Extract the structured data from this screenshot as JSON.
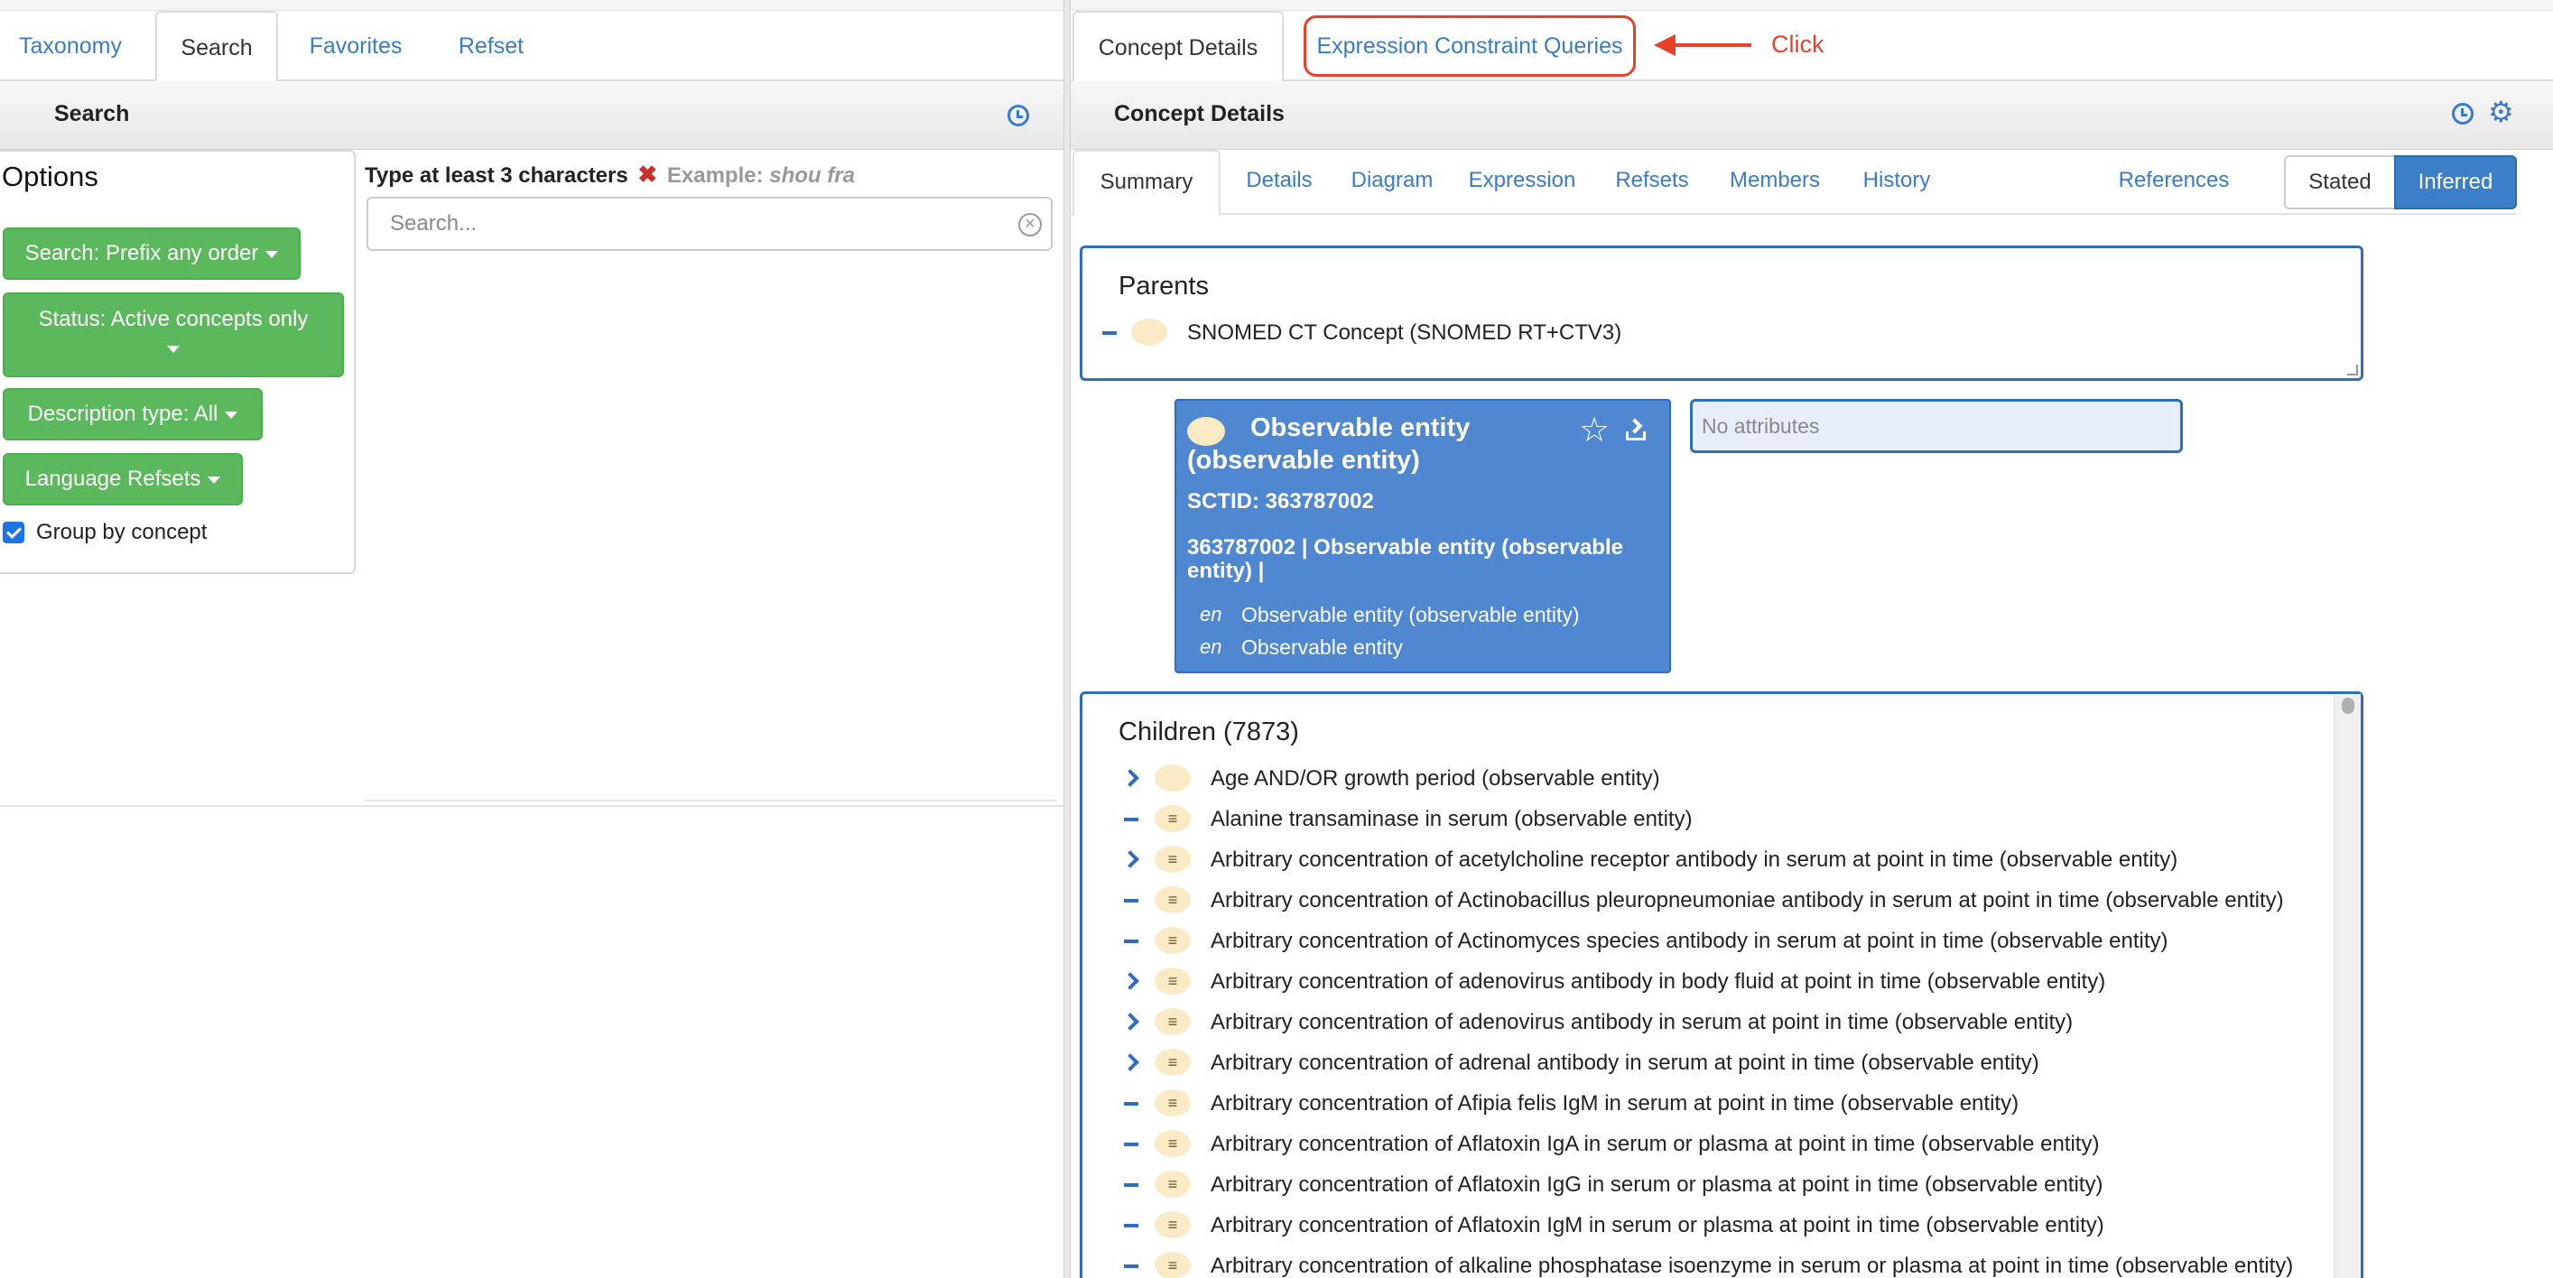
{
  "left": {
    "tabs": [
      "Taxonomy",
      "Search",
      "Favorites",
      "Refset"
    ],
    "active_tab": "Search",
    "panel_title": "Search",
    "options": {
      "title": "Options",
      "search_mode": "Search: Prefix any order",
      "status": "Status: Active concepts only",
      "description_type": "Description type: All",
      "language_refsets": "Language Refsets",
      "group_by_concept": "Group by concept",
      "group_by_checked": true
    },
    "hint": {
      "text": "Type at least 3 characters",
      "x": "✖",
      "example_label": "Example:",
      "example_value": "shou fra"
    },
    "search_placeholder": "Search..."
  },
  "right": {
    "tabs": [
      "Concept Details",
      "Expression Constraint Queries"
    ],
    "active_tab": "Concept Details",
    "annotation": "Click",
    "panel_title": "Concept Details",
    "subtabs": [
      "Summary",
      "Details",
      "Diagram",
      "Expression",
      "Refsets",
      "Members",
      "History",
      "References"
    ],
    "active_subtab": "Summary",
    "view_toggle": {
      "stated": "Stated",
      "inferred": "Inferred",
      "selected": "Inferred"
    },
    "parents": {
      "title": "Parents",
      "items": [
        "SNOMED CT Concept (SNOMED RT+CTV3)"
      ]
    },
    "focus": {
      "fsn": "Observable entity (observable entity)",
      "sctid": "SCTID: 363787002",
      "full_term": "363787002 | Observable entity (observable entity) |",
      "descriptions": [
        {
          "lang": "en",
          "term": "Observable entity (observable entity)"
        },
        {
          "lang": "en",
          "term": "Observable entity"
        }
      ]
    },
    "attributes_placeholder": "No attributes",
    "children": {
      "title": "Children (7873)",
      "items": [
        {
          "label": "Age AND/OR growth period (observable entity)",
          "expand": true,
          "primitive": true
        },
        {
          "label": "Alanine transaminase in serum (observable entity)",
          "expand": false,
          "primitive": false
        },
        {
          "label": "Arbitrary concentration of acetylcholine receptor antibody in serum at point in time (observable entity)",
          "expand": true,
          "primitive": false
        },
        {
          "label": "Arbitrary concentration of Actinobacillus pleuropneumoniae antibody in serum at point in time (observable entity)",
          "expand": false,
          "primitive": false
        },
        {
          "label": "Arbitrary concentration of Actinomyces species antibody in serum at point in time (observable entity)",
          "expand": false,
          "primitive": false
        },
        {
          "label": "Arbitrary concentration of adenovirus antibody in body fluid at point in time (observable entity)",
          "expand": true,
          "primitive": false
        },
        {
          "label": "Arbitrary concentration of adenovirus antibody in serum at point in time (observable entity)",
          "expand": true,
          "primitive": false
        },
        {
          "label": "Arbitrary concentration of adrenal antibody in serum at point in time (observable entity)",
          "expand": true,
          "primitive": false
        },
        {
          "label": "Arbitrary concentration of Afipia felis IgM in serum at point in time (observable entity)",
          "expand": false,
          "primitive": false
        },
        {
          "label": "Arbitrary concentration of Aflatoxin IgA in serum or plasma at point in time (observable entity)",
          "expand": false,
          "primitive": false
        },
        {
          "label": "Arbitrary concentration of Aflatoxin IgG in serum or plasma at point in time (observable entity)",
          "expand": false,
          "primitive": false
        },
        {
          "label": "Arbitrary concentration of Aflatoxin IgM in serum or plasma at point in time (observable entity)",
          "expand": false,
          "primitive": false
        },
        {
          "label": "Arbitrary concentration of alkaline phosphatase isoenzyme in serum or plasma at point in time (observable entity)",
          "expand": false,
          "primitive": false
        }
      ]
    }
  },
  "colors": {
    "link_blue": "#3a7bc8",
    "button_green": "#5cb85c",
    "concept_blue": "#4f88d0",
    "annotation_red": "#e8412a"
  }
}
